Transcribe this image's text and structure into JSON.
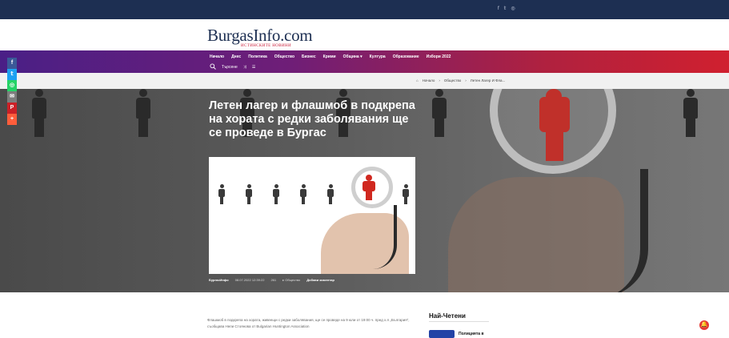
{
  "topbar": {
    "social": [
      "f",
      "𝕥",
      "◎"
    ]
  },
  "logo": {
    "name": "BurgasInfo.com",
    "tagline": "ИСТИНСКИТЕ НОВИНИ"
  },
  "nav": {
    "items": [
      "Начало",
      "Днес",
      "Политика",
      "Общество",
      "Бизнес",
      "Крими",
      "Община ▾",
      "Култура",
      "Образование",
      "Избори 2022"
    ],
    "search_label": "Търсене",
    "shuffle_icon": "⤨",
    "menu_icon": "☰"
  },
  "breadcrumb": {
    "home": "Начало",
    "sep": "›",
    "section": "Общество",
    "current": "Летен Лагер И Фла..."
  },
  "article": {
    "title": "Летен лагер и флашмоб в подкрепа на хората с редки заболявания ще се проведе в Бургас",
    "author": "БургасИнфо",
    "date": "08.07.2022 12:39:22",
    "views": "261",
    "section": "Общество",
    "comment": "Добави коментар",
    "body": "Флашмоб в подкрепа на хората, живеещи с редки заболявания, ще се проведе на 9 юли от 19:00 ч. пред х.л „България“, съобщава Нели Стоянова от Bulgarian Huntington Association"
  },
  "share": [
    {
      "icon": "facebook-icon",
      "label": "f",
      "color": "#3b5998"
    },
    {
      "icon": "twitter-icon",
      "label": "𝕥",
      "color": "#1da1f2"
    },
    {
      "icon": "whatsapp-icon",
      "label": "◎",
      "color": "#25d366"
    },
    {
      "icon": "email-icon",
      "label": "✉",
      "color": "#7d7d7d"
    },
    {
      "icon": "pinterest-icon",
      "label": "P",
      "color": "#cb2027"
    },
    {
      "icon": "more-icon",
      "label": "+",
      "color": "#ff5d3b"
    }
  ],
  "sidebar": {
    "heading": "Най-Четени",
    "item_title": "Полицията в"
  },
  "colors": {
    "topbar": "#1d2f52",
    "accent": "#c8102e",
    "nav_start": "#4a1f86",
    "nav_end": "#d0202f"
  }
}
